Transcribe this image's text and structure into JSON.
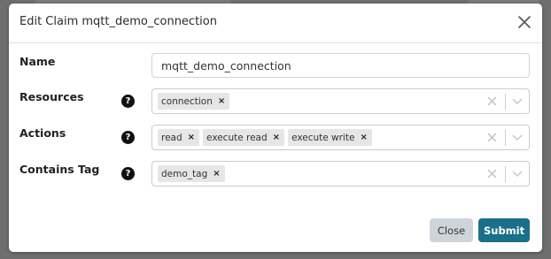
{
  "modal": {
    "title": "Edit Claim mqtt_demo_connection",
    "close_icon": "close-icon"
  },
  "form": {
    "name": {
      "label": "Name",
      "value": "mqtt_demo_connection"
    },
    "resources": {
      "label": "Resources",
      "chips": [
        "connection"
      ]
    },
    "actions": {
      "label": "Actions",
      "chips": [
        "read",
        "execute read",
        "execute write"
      ]
    },
    "contains_tag": {
      "label": "Contains Tag",
      "chips": [
        "demo_tag"
      ]
    },
    "help_glyph": "?",
    "chip_remove_glyph": "×"
  },
  "footer": {
    "close_label": "Close",
    "submit_label": "Submit"
  },
  "colors": {
    "submit_bg": "#1a6f8a",
    "close_bg": "#ced4da",
    "chip_bg": "#e6e6e6",
    "overlay": "#6e6e6e"
  }
}
